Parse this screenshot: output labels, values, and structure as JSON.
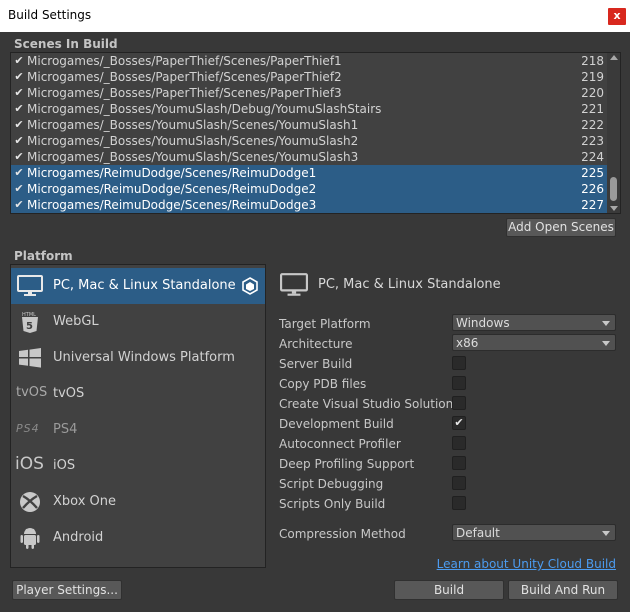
{
  "window": {
    "title": "Build Settings",
    "close_label": "x"
  },
  "scenes": {
    "label": "Scenes In Build",
    "rows": [
      {
        "path": "Microgames/_Bosses/PaperThief/Scenes/PaperThief1",
        "index": "218",
        "checked": "✔",
        "selected": false
      },
      {
        "path": "Microgames/_Bosses/PaperThief/Scenes/PaperThief2",
        "index": "219",
        "checked": "✔",
        "selected": false
      },
      {
        "path": "Microgames/_Bosses/PaperThief/Scenes/PaperThief3",
        "index": "220",
        "checked": "✔",
        "selected": false
      },
      {
        "path": "Microgames/_Bosses/YoumuSlash/Debug/YoumuSlashStairs",
        "index": "221",
        "checked": "✔",
        "selected": false
      },
      {
        "path": "Microgames/_Bosses/YoumuSlash/Scenes/YoumuSlash1",
        "index": "222",
        "checked": "✔",
        "selected": false
      },
      {
        "path": "Microgames/_Bosses/YoumuSlash/Scenes/YoumuSlash2",
        "index": "223",
        "checked": "✔",
        "selected": false
      },
      {
        "path": "Microgames/_Bosses/YoumuSlash/Scenes/YoumuSlash3",
        "index": "224",
        "checked": "✔",
        "selected": false
      },
      {
        "path": "Microgames/ReimuDodge/Scenes/ReimuDodge1",
        "index": "225",
        "checked": "✔",
        "selected": true
      },
      {
        "path": "Microgames/ReimuDodge/Scenes/ReimuDodge2",
        "index": "226",
        "checked": "✔",
        "selected": true
      },
      {
        "path": "Microgames/ReimuDodge/Scenes/ReimuDodge3",
        "index": "227",
        "checked": "✔",
        "selected": true
      }
    ],
    "add_open_scenes_label": "Add Open Scenes"
  },
  "platform": {
    "label": "Platform",
    "items": [
      {
        "name": "PC, Mac & Linux Standalone",
        "icon": "monitor-icon",
        "selected": true
      },
      {
        "name": "WebGL",
        "icon": "html5-icon",
        "selected": false
      },
      {
        "name": "Universal Windows Platform",
        "icon": "windows-icon",
        "selected": false
      },
      {
        "name": "tvOS",
        "icon": "tvos-icon",
        "icon_text": "tvOS",
        "selected": false
      },
      {
        "name": "PS4",
        "icon": "ps4-icon",
        "icon_text": "PS4",
        "selected": false,
        "dim": true
      },
      {
        "name": "iOS",
        "icon": "ios-icon",
        "icon_text": "iOS",
        "selected": false
      },
      {
        "name": "Xbox One",
        "icon": "xbox-icon",
        "selected": false
      },
      {
        "name": "Android",
        "icon": "android-icon",
        "selected": false
      }
    ]
  },
  "settings": {
    "header": "PC, Mac & Linux Standalone",
    "target_platform": {
      "label": "Target Platform",
      "value": "Windows"
    },
    "architecture": {
      "label": "Architecture",
      "value": "x86"
    },
    "server_build": {
      "label": "Server Build",
      "mark": ""
    },
    "copy_pdb": {
      "label": "Copy PDB files",
      "mark": ""
    },
    "create_vs_solution": {
      "label": "Create Visual Studio Solution",
      "mark": ""
    },
    "development_build": {
      "label": "Development Build",
      "mark": "✔"
    },
    "autoconnect_profiler": {
      "label": "Autoconnect Profiler",
      "mark": ""
    },
    "deep_profiling": {
      "label": "Deep Profiling Support",
      "mark": ""
    },
    "script_debugging": {
      "label": "Script Debugging",
      "mark": ""
    },
    "scripts_only_build": {
      "label": "Scripts Only Build",
      "mark": ""
    },
    "compression": {
      "label": "Compression Method",
      "value": "Default"
    },
    "cloud_link": "Learn about Unity Cloud Build"
  },
  "footer": {
    "player_settings_label": "Player Settings...",
    "build_label": "Build",
    "build_and_run_label": "Build And Run"
  },
  "colors": {
    "selection": "#2c5d87",
    "background": "#383838",
    "link": "#4c9cf0"
  }
}
